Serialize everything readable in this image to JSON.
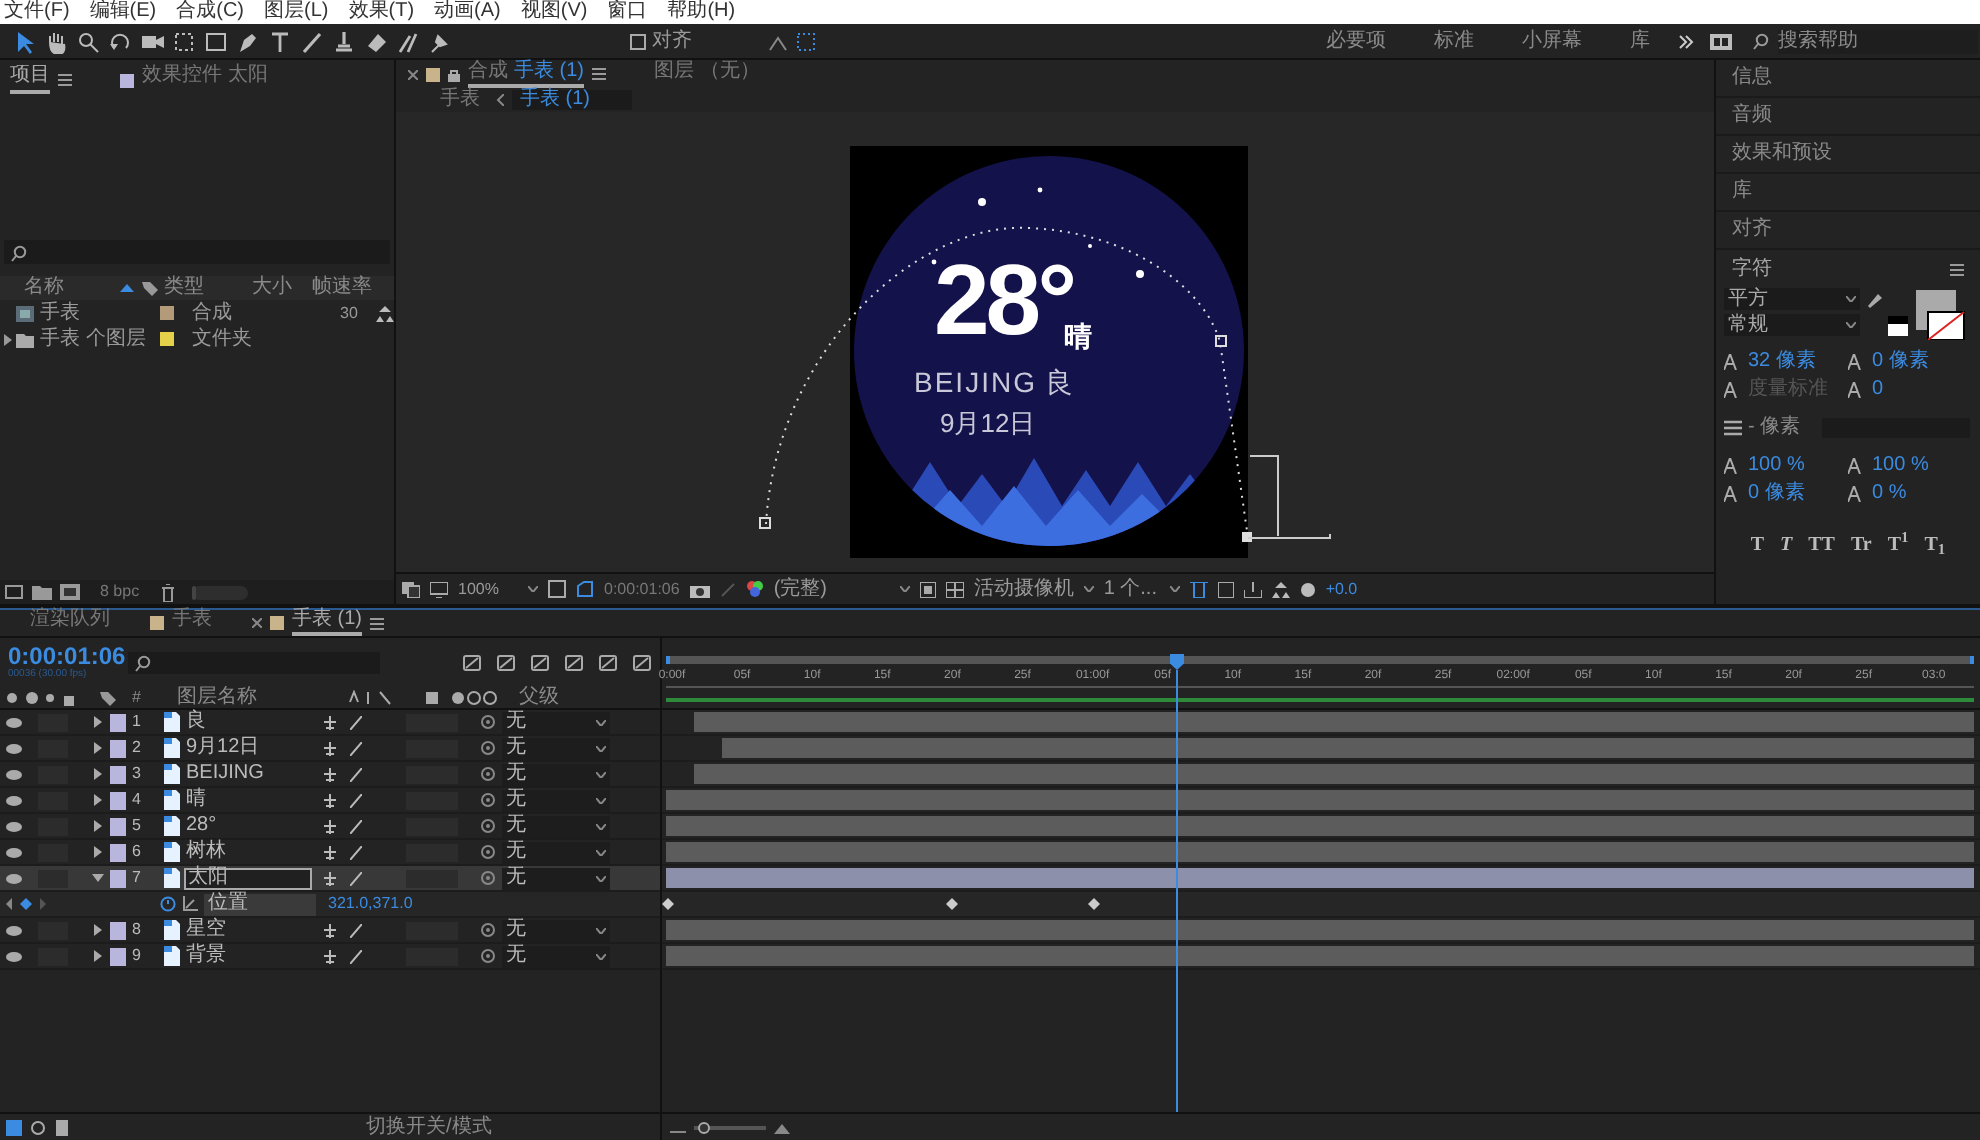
{
  "menu_bar": [
    "文件(F)",
    "编辑(E)",
    "合成(C)",
    "图层(L)",
    "效果(T)",
    "动画(A)",
    "视图(V)",
    "窗口",
    "帮助(H)"
  ],
  "toolbar": {
    "snap": {
      "label": "对齐",
      "checked": false
    }
  },
  "workspaces": [
    {
      "label": "必要项",
      "selected": false
    },
    {
      "label": "标准",
      "selected": false
    },
    {
      "label": "小屏幕",
      "selected": false
    },
    {
      "label": "库",
      "selected": false
    }
  ],
  "search_help": {
    "placeholder": "搜索帮助"
  },
  "project_panel": {
    "tabs": [
      {
        "label": "项目",
        "selected": true
      },
      {
        "label": "效果控件 太阳",
        "selected": false
      }
    ],
    "columns": [
      "名称",
      "类型",
      "大小",
      "帧速率"
    ],
    "items": [
      {
        "name": "手表",
        "kind": "composition",
        "type": "合成",
        "color": "#b39b7a",
        "frame_rate": "30"
      },
      {
        "name": "手表 个图层",
        "kind": "folder",
        "type": "文件夹",
        "color": "#e5d04a"
      }
    ],
    "bit_depth": "8 bpc",
    "thumbnail_size": {
      "level": 0.1
    }
  },
  "composition_panel": {
    "tabs": [
      {
        "prefix": "合成",
        "label": "手表 (1)",
        "selected": true
      },
      {
        "prefix": "图层",
        "label": "（无）",
        "selected": false
      }
    ],
    "breadcrumbs": [
      {
        "label": "手表",
        "selected": false
      },
      {
        "label": "手表 (1)",
        "selected": true
      }
    ],
    "canvas": {
      "temperature": "28°",
      "weather": "晴",
      "city": "BEIJING",
      "air_quality": "良",
      "date": "9月12日"
    },
    "bottom_bar": {
      "zoom": "100%",
      "timecode": "0:00:01:06",
      "resolution": "(完整)",
      "camera": "活动摄像机",
      "views": "1 个...",
      "exposure": "+0.0"
    }
  },
  "right_panel": {
    "sections": [
      "信息",
      "音频",
      "效果和预设",
      "库",
      "对齐"
    ],
    "character": {
      "title": "字符",
      "font": "平方",
      "style": "常规",
      "size": "32 像素",
      "leading": "0 像素",
      "kerning": "度量标准",
      "tracking": "0",
      "stroke": "- 像素",
      "vertical_scale": "100 %",
      "horizontal_scale": "100 %",
      "baseline_shift": "0 像素",
      "tsume": "0 %",
      "styles": [
        "T",
        "T",
        "TT",
        "Tr",
        "T$^{1}$",
        "T$_{1}$"
      ]
    }
  },
  "timeline": {
    "tabs": [
      {
        "label": "渲染队列",
        "selected": false
      },
      {
        "label": "手表",
        "selected": false
      },
      {
        "label": "手表 (1)",
        "selected": true
      }
    ],
    "timecode": "0:00:01:06",
    "frame_info": "00036 (30.00 fps)",
    "columns": {
      "number": "#",
      "layer_name": "图层名称",
      "parent": "父级"
    },
    "layers": [
      {
        "number": "1",
        "name": "良",
        "parent": "无",
        "expanded": false,
        "selected": false
      },
      {
        "number": "2",
        "name": "9月12日",
        "parent": "无",
        "expanded": false,
        "selected": false
      },
      {
        "number": "3",
        "name": "BEIJING",
        "parent": "无",
        "expanded": false,
        "selected": false
      },
      {
        "number": "4",
        "name": "晴",
        "parent": "无",
        "expanded": false,
        "selected": false
      },
      {
        "number": "5",
        "name": "28°",
        "parent": "无",
        "expanded": false,
        "selected": false
      },
      {
        "number": "6",
        "name": "树林",
        "parent": "无",
        "expanded": false,
        "selected": false
      },
      {
        "number": "7",
        "name": "太阳",
        "parent": "无",
        "expanded": true,
        "selected": true,
        "properties": [
          {
            "name": "位置",
            "value": "321.0,371.0"
          }
        ]
      },
      {
        "number": "8",
        "name": "星空",
        "parent": "无",
        "expanded": false,
        "selected": false
      },
      {
        "number": "9",
        "name": "背景",
        "parent": "无",
        "expanded": false,
        "selected": false
      }
    ],
    "ruler": [
      "0:00f",
      "05f",
      "10f",
      "15f",
      "20f",
      "25f",
      "01:00f",
      "05f",
      "10f",
      "15f",
      "20f",
      "25f",
      "02:00f",
      "05f",
      "10f",
      "15f",
      "20f",
      "25f",
      "03:0"
    ],
    "footer": "切换开关/模式",
    "zoom": {
      "level": 0.05
    }
  }
}
